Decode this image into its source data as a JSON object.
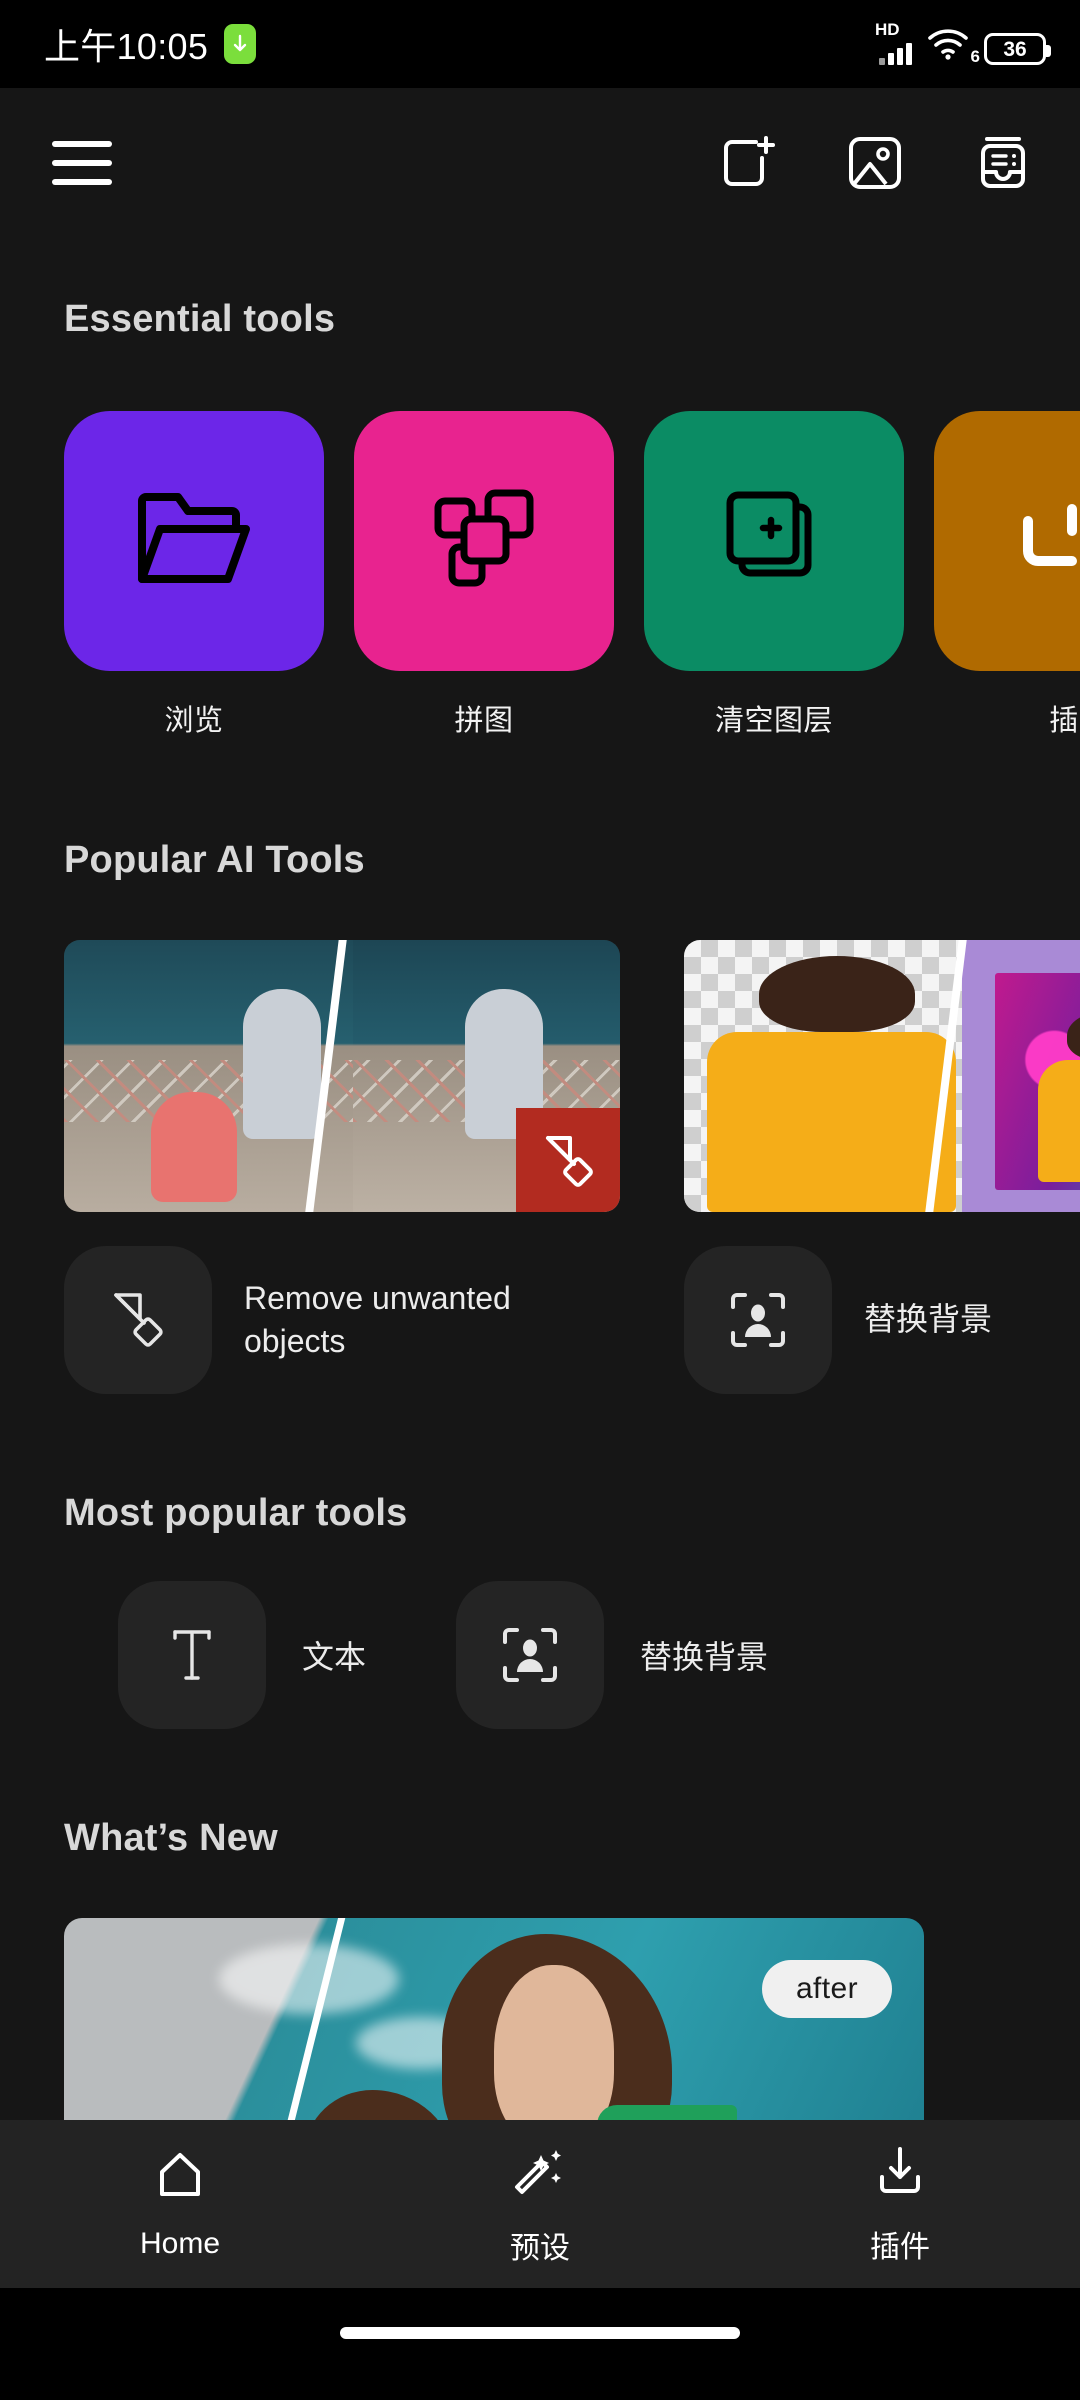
{
  "status_bar": {
    "time": "上午10:05",
    "download_icon": "download-arrow-icon",
    "network_label": "HD",
    "wifi_generation": "6",
    "battery_percent": "36"
  },
  "toolbar": {
    "menu_icon": "hamburger-menu-icon",
    "actions": [
      {
        "icon": "new-project-icon",
        "name": "new-project-button"
      },
      {
        "icon": "gallery-image-icon",
        "name": "gallery-button"
      },
      {
        "icon": "inbox-news-icon",
        "name": "news-button"
      }
    ]
  },
  "essential_tools": {
    "title": "Essential tools",
    "items": [
      {
        "label": "浏览",
        "color": "#6C26E8",
        "icon": "folder-icon"
      },
      {
        "label": "拼图",
        "color": "#E8238F",
        "icon": "collage-layers-icon"
      },
      {
        "label": "清空图层",
        "color": "#0B8C64",
        "icon": "add-layer-icon"
      },
      {
        "label": "插",
        "color": "#B06A00",
        "icon": "plugin-icon"
      }
    ]
  },
  "popular_ai_tools": {
    "title": "Popular AI Tools",
    "items": [
      {
        "label": "Remove unwanted objects",
        "icon": "remove-object-icon",
        "thumb": "before-after-object-removal"
      },
      {
        "label": "替换背景",
        "icon": "portrait-frame-icon",
        "thumb": "before-after-background-replace"
      }
    ]
  },
  "most_popular_tools": {
    "title": "Most popular tools",
    "items": [
      {
        "label": "文本",
        "icon": "text-tool-icon"
      },
      {
        "label": "替换背景",
        "icon": "portrait-frame-icon"
      }
    ]
  },
  "whats_new": {
    "title": "What’s New",
    "card_badge": "after"
  },
  "bottom_nav": {
    "items": [
      {
        "label": "Home",
        "icon": "home-icon",
        "active": true
      },
      {
        "label": "预设",
        "icon": "magic-wand-icon",
        "active": false
      },
      {
        "label": "插件",
        "icon": "download-plugin-icon",
        "active": false
      }
    ]
  },
  "colors": {
    "app_background": "#161616",
    "nav_background": "#232323",
    "tile_surface": "#242424",
    "heading_text": "#d8d8d8",
    "body_text": "#ececec",
    "badge_red": "#b22b20",
    "battery_green": "#7BDE3C"
  }
}
